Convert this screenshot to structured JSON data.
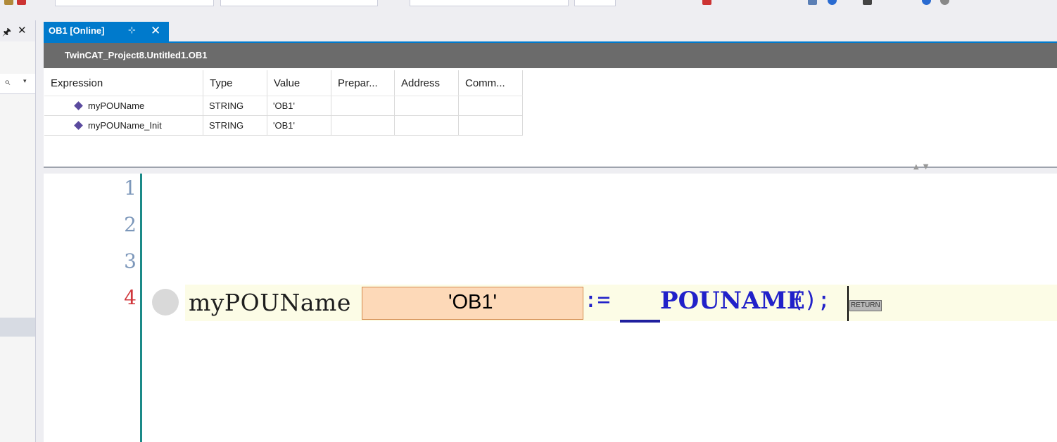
{
  "document": {
    "tab_label": "OB1 [Online]",
    "path": "TwinCAT_Project8.Untitled1.OB1"
  },
  "declarations": {
    "columns": [
      "Expression",
      "Type",
      "Value",
      "Prepar...",
      "Address",
      "Comm..."
    ],
    "rows": [
      {
        "expression": "myPOUName",
        "type": "STRING",
        "value": "'OB1'",
        "prepared": "",
        "address": "",
        "comment": ""
      },
      {
        "expression": "myPOUName_Init",
        "type": "STRING",
        "value": "'OB1'",
        "prepared": "",
        "address": "",
        "comment": ""
      }
    ]
  },
  "editor": {
    "line_numbers": [
      "1",
      "2",
      "3",
      "4"
    ],
    "active_line": "4",
    "code": {
      "identifier": "myPOUName",
      "online_value": "'OB1'",
      "assign_operator": ":=",
      "function_name": "__POUNAME",
      "call_suffix": "();",
      "return_marker": "RETURN"
    }
  },
  "colors": {
    "tab_active": "#007acc",
    "path_bar": "#6b6b6b",
    "keyword": "#2121c9",
    "inline_value_bg": "#fdd9b8",
    "active_line_number": "#d0363b",
    "gutter_line": "#1b8a88"
  },
  "icons": [
    "pin-icon",
    "close-icon",
    "search-icon",
    "variable-icon",
    "breakpoint-icon"
  ]
}
